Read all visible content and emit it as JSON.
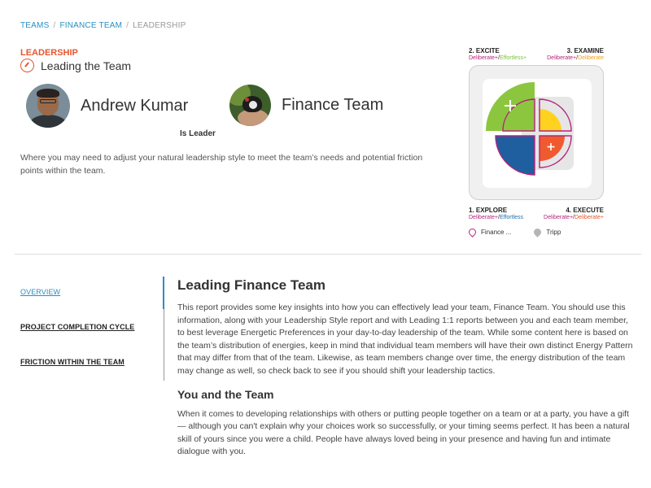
{
  "breadcrumb": {
    "items": [
      "TEAMS",
      "FINANCE TEAM"
    ],
    "current": "LEADERSHIP",
    "separator": "/"
  },
  "header": {
    "section_label": "LEADERSHIP",
    "section_title": "Leading the Team",
    "section_icon": "compass-icon"
  },
  "leader": {
    "name": "Andrew Kumar"
  },
  "team": {
    "name": "Finance Team"
  },
  "relation_label": "Is Leader",
  "intro_text": "Where you may need to adjust your natural leadership style to meet the team’s needs and potential friction points within the team.",
  "quadrant": {
    "top_left_title": "2. EXCITE",
    "top_left_sub": [
      "Deliberate+",
      "/",
      "Effortless+"
    ],
    "top_right_title": "3. EXAMINE",
    "top_right_sub": [
      "Deliberate+",
      "/",
      "Deliberate"
    ],
    "bottom_left_title": "1. EXPLORE",
    "bottom_left_sub": [
      "Deliberate+",
      "/",
      "Effortless"
    ],
    "bottom_right_title": "4. EXECUTE",
    "bottom_right_sub": [
      "Deliberate+",
      "/",
      "Deliberate+"
    ],
    "legend": [
      "Finance ...",
      "Tripp"
    ],
    "colors": {
      "excite": "#8cc63f",
      "examine": "#ffd21f",
      "explore": "#1f5fa0",
      "execute": "#ef5b2f",
      "outline": "#b5247a"
    }
  },
  "side_nav": {
    "items": [
      "OVERVIEW",
      "PROJECT COMPLETION CYCLE",
      "FRICTION WITHIN THE TEAM"
    ],
    "active_index": 0
  },
  "content": {
    "title": "Leading Finance Team",
    "para1": "This report provides some key insights into how you can effectively lead your team, Finance Team. You should use this information, along with your Leadership Style report and with Leading 1:1 reports between you and each team member, to best leverage Energetic Preferences in your day-to-day leadership of the team. While some content here is based on the team’s distribution of energies, keep in mind that individual team members will have their own distinct Energy Pattern that may differ from that of the team. Likewise, as team members change over time, the energy distribution of the team may change as well, so check back to see if you should shift your leadership tactics.",
    "subtitle": "You and the Team",
    "para2": "When it comes to developing relationships with others or putting people together on a team or at a party, you have a gift — although you can't explain why your choices work so successfully, or your timing seems perfect. It has been a natural skill of yours since you were a child. People have always loved being in your presence and having fun and intimate dialogue with you."
  }
}
